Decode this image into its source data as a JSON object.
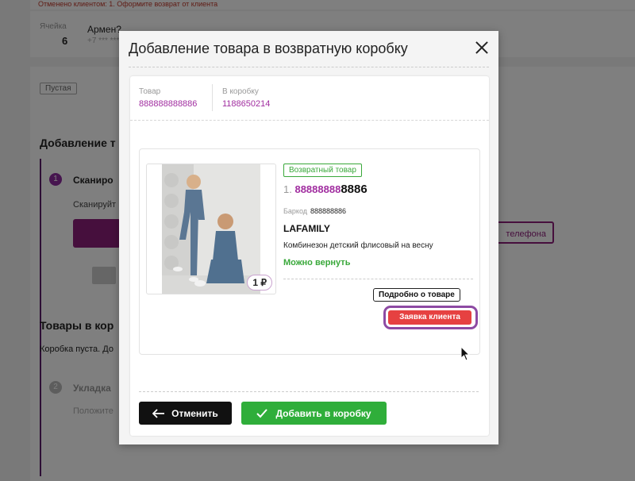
{
  "background": {
    "top_notice": "Отменено клиентом: 1. Оформите возврат от клиента",
    "cell_label": "Ячейка",
    "cell_value": "6",
    "client_name": "Армен?",
    "client_phone": "+7 *** ***",
    "status_badge": "Пустая",
    "section_add_title": "Добавление т",
    "step1_number": "1",
    "step1_title": "Сканиро",
    "step1_hint": "Сканируйт",
    "phone_button": "телефона",
    "section_box_title": "Товары в кор",
    "box_empty_text": "Коробка пуста. До",
    "step2_number": "2",
    "step2_title": "Укладка",
    "step2_hint": "Положите"
  },
  "modal": {
    "title": "Добавление товара в возвратную коробку",
    "info": {
      "product_label": "Товар",
      "product_value": "888888888886",
      "box_label": "В коробку",
      "box_value": "1188650214"
    },
    "product": {
      "return_badge": "Возвратный товар",
      "index": "1.",
      "number_light": "88888888",
      "number_dark": "8886",
      "barcode_label": "Баркод",
      "barcode_value": "888888886",
      "brand": "LAFAMILY",
      "name": "Комбинезон детский флисовый на весну",
      "status": "Можно вернуть",
      "price": "1 ₽",
      "details_button": "Подробно о товаре",
      "request_button": "Заявка клиента"
    },
    "buttons": {
      "cancel": "Отменить",
      "add": "Добавить в коробку"
    }
  }
}
